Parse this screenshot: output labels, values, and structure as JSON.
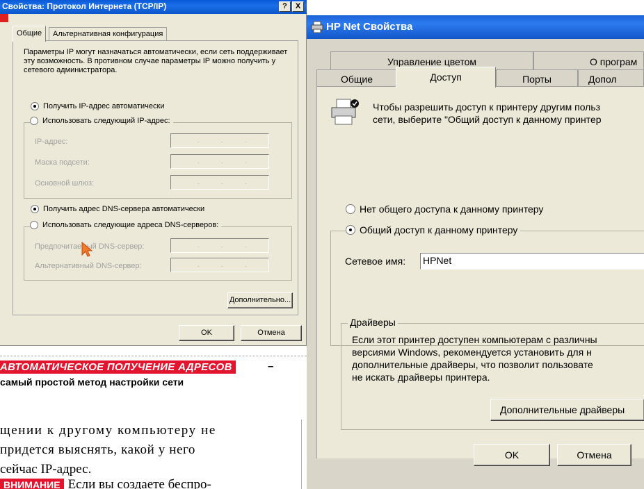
{
  "tcpip_dialog": {
    "title": "Свойства: Протокол Интернета (TCP/IP)",
    "help_btn": "?",
    "close_btn": "X",
    "tabs": [
      "Общие",
      "Альтернативная конфигурация"
    ],
    "description": "Параметры IP могут назначаться автоматически, если сеть поддерживает эту возможность. В противном случае параметры IP можно получить у сетевого администратора.",
    "radio_ip_auto": "Получить IP-адрес автоматически",
    "radio_ip_manual": "Использовать следующий IP-адрес:",
    "ip_fields": [
      "IP-адрес:",
      "Маска подсети:",
      "Основной шлюз:"
    ],
    "radio_dns_auto": "Получить адрес DNS-сервера автоматически",
    "radio_dns_manual": "Использовать следующие адреса DNS-серверов:",
    "dns_fields": [
      "Предпочитаемый DNS-сервер:",
      "Альтернативный DNS-сервер:"
    ],
    "advanced_btn": "Дополнительно...",
    "ok_btn": "OK",
    "cancel_btn": "Отмена"
  },
  "caption": {
    "highlight": "АВТОМАТИЧЕСКОЕ ПОЛУЧЕНИЕ АДРЕСОВ",
    "dash": "–",
    "subtitle": "самый простой метод настройки сети"
  },
  "article": {
    "lines": [
      "щении к другому компьютеру не",
      "придется выяснять, какой у него",
      "сейчас IP-адрес."
    ],
    "warning_tag": "ВНИМАНИЕ",
    "warning_text": "Если вы создаете беспро-"
  },
  "hp_dialog": {
    "title": "HP Net Свойства",
    "tabs_back": [
      "Управление цветом",
      "О програм"
    ],
    "tabs_front": [
      "Общие",
      "Доступ",
      "Порты",
      "Допол"
    ],
    "info_lines": [
      "Чтобы разрешить доступ к принтеру другим польз",
      "сети, выберите \"Общий доступ к данному принтер"
    ],
    "radio_no_share": "Нет общего доступа к данному принтеру",
    "radio_share": "Общий доступ к данному принтеру",
    "network_name_label": "Сетевое имя:",
    "network_name_value": "HPNet",
    "drivers_group": "Драйверы",
    "drivers_lines": [
      "Если этот принтер доступен компьютерам с различны",
      "версиями Windows, рекомендуется установить для н",
      "дополнительные драйверы, что позволит пользовате",
      "не искать драйверы принтера."
    ],
    "drivers_btn": "Дополнительные драйверы",
    "ok_btn": "OK",
    "cancel_btn": "Отмена"
  },
  "colors": {
    "accent_red": "#e3142d",
    "xp_blue": "#0a5ad8",
    "dialog_bg": "#ece9d8"
  }
}
